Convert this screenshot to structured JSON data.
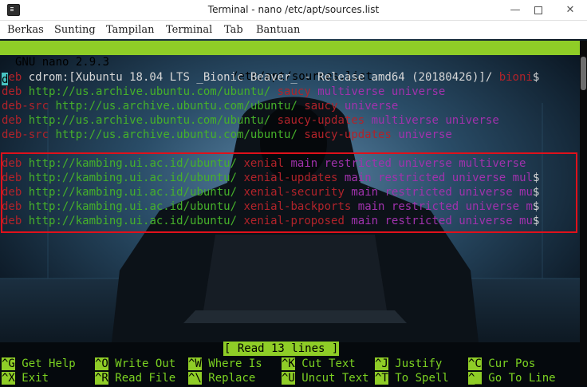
{
  "window": {
    "title": "Terminal - nano /etc/apt/sources.list",
    "minimize_label": "—",
    "close_label": "✕"
  },
  "menu": [
    "Berkas",
    "Sunting",
    "Tampilan",
    "Terminal",
    "Tab",
    "Bantuan"
  ],
  "nano": {
    "version": "GNU nano 2.9.3",
    "filename": "/etc/apt/sources.list",
    "status": "[ Read 13 lines ]"
  },
  "lines": [
    {
      "cmd": "eb",
      "cursor": "d",
      "rest": "cdrom:[Xubuntu 18.04 LTS _Bionic Beaver_ - Release amd64 (20180426)]/ ",
      "suite": "bioni",
      "overflow": "$"
    },
    {
      "cmd": "deb",
      "url": "http://us.archive.ubuntu.com/ubuntu/",
      "suite": "saucy",
      "comps": "multiverse universe"
    },
    {
      "cmd": "deb-src",
      "url": "http://us.archive.ubuntu.com/ubuntu/",
      "suite": "saucy",
      "comps": "universe"
    },
    {
      "cmd": "deb",
      "url": "http://us.archive.ubuntu.com/ubuntu/",
      "suite": "saucy-updates",
      "comps": "multiverse universe"
    },
    {
      "cmd": "deb-src",
      "url": "http://us.archive.ubuntu.com/ubuntu/",
      "suite": "saucy-updates",
      "comps": "universe"
    },
    {
      "cmd": "deb",
      "url": "http://kambing.ui.ac.id/ubuntu/",
      "suite": "xenial",
      "comps": "main restricted universe multiverse",
      "overflow": ""
    },
    {
      "cmd": "deb",
      "url": "http://kambing.ui.ac.id/ubuntu/",
      "suite": "xenial-updates",
      "comps": "main restricted universe mul",
      "overflow": "$"
    },
    {
      "cmd": "deb",
      "url": "http://kambing.ui.ac.id/ubuntu/",
      "suite": "xenial-security",
      "comps": "main restricted universe mu",
      "overflow": "$"
    },
    {
      "cmd": "deb",
      "url": "http://kambing.ui.ac.id/ubuntu/",
      "suite": "xenial-backports",
      "comps": "main restricted universe m",
      "overflow": "$"
    },
    {
      "cmd": "deb",
      "url": "http://kambing.ui.ac.id/ubuntu/",
      "suite": "xenial-proposed",
      "comps": "main restricted universe mu",
      "overflow": "$"
    }
  ],
  "shortcuts_row1": [
    {
      "key": "^G",
      "label": "Get Help"
    },
    {
      "key": "^O",
      "label": "Write Out"
    },
    {
      "key": "^W",
      "label": "Where Is"
    },
    {
      "key": "^K",
      "label": "Cut Text"
    },
    {
      "key": "^J",
      "label": "Justify"
    },
    {
      "key": "^C",
      "label": "Cur Pos"
    }
  ],
  "shortcuts_row2": [
    {
      "key": "^X",
      "label": "Exit"
    },
    {
      "key": "^R",
      "label": "Read File"
    },
    {
      "key": "^\\",
      "label": "Replace"
    },
    {
      "key": "^U",
      "label": "Uncut Text"
    },
    {
      "key": "^T",
      "label": "To Spell"
    },
    {
      "key": "^_",
      "label": "Go To Line"
    }
  ],
  "colors": {
    "nano_bar": "#8fcd27",
    "highlight_box": "#e0111b",
    "keyword": "#b1232a",
    "url": "#46b12a",
    "component": "#a132ad"
  }
}
